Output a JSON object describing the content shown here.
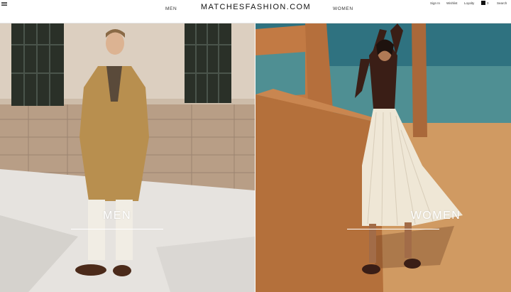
{
  "header": {
    "logo": "MATCHESFASHION.COM",
    "nav": {
      "men": "MEN",
      "women": "WOMEN"
    },
    "utilities": {
      "sign_in": "Sign In",
      "wishlist": "Wishlist",
      "loyalty": "Loyalty",
      "bag_count": "0",
      "search": "Search"
    },
    "icons": {
      "menu": "hamburger-icon",
      "bag": "shopping-bag-icon"
    }
  },
  "panels": {
    "men": {
      "label": "MEN"
    },
    "women": {
      "label": "WOMEN"
    }
  },
  "colors": {
    "label_text": "#ffffff",
    "header_bg": "#ffffff"
  }
}
